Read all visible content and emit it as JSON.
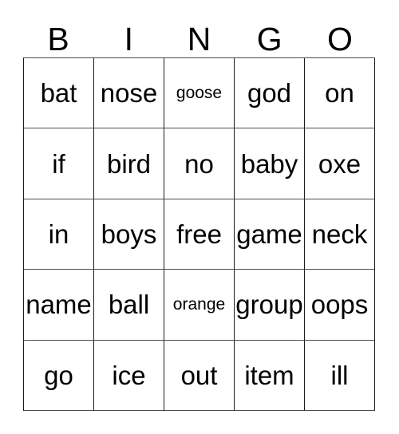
{
  "card": {
    "headers": [
      "B",
      "I",
      "N",
      "G",
      "O"
    ],
    "rows": [
      [
        {
          "text": "bat",
          "shrink": false
        },
        {
          "text": "nose",
          "shrink": false
        },
        {
          "text": "goose",
          "shrink": true
        },
        {
          "text": "god",
          "shrink": false
        },
        {
          "text": "on",
          "shrink": false
        }
      ],
      [
        {
          "text": "if",
          "shrink": false
        },
        {
          "text": "bird",
          "shrink": false
        },
        {
          "text": "no",
          "shrink": false
        },
        {
          "text": "baby",
          "shrink": false
        },
        {
          "text": "oxe",
          "shrink": false
        }
      ],
      [
        {
          "text": "in",
          "shrink": false
        },
        {
          "text": "boys",
          "shrink": false
        },
        {
          "text": "free",
          "shrink": false
        },
        {
          "text": "game",
          "shrink": false
        },
        {
          "text": "neck",
          "shrink": false
        }
      ],
      [
        {
          "text": "name",
          "shrink": false
        },
        {
          "text": "ball",
          "shrink": false
        },
        {
          "text": "orange",
          "shrink": true
        },
        {
          "text": "group",
          "shrink": false
        },
        {
          "text": "oops",
          "shrink": false
        }
      ],
      [
        {
          "text": "go",
          "shrink": false
        },
        {
          "text": "ice",
          "shrink": false
        },
        {
          "text": "out",
          "shrink": false
        },
        {
          "text": "item",
          "shrink": false
        },
        {
          "text": "ill",
          "shrink": false
        }
      ]
    ],
    "colors": {
      "background": "#ffffff",
      "text": "#000000",
      "grid_line": "#1a1a1a"
    }
  }
}
